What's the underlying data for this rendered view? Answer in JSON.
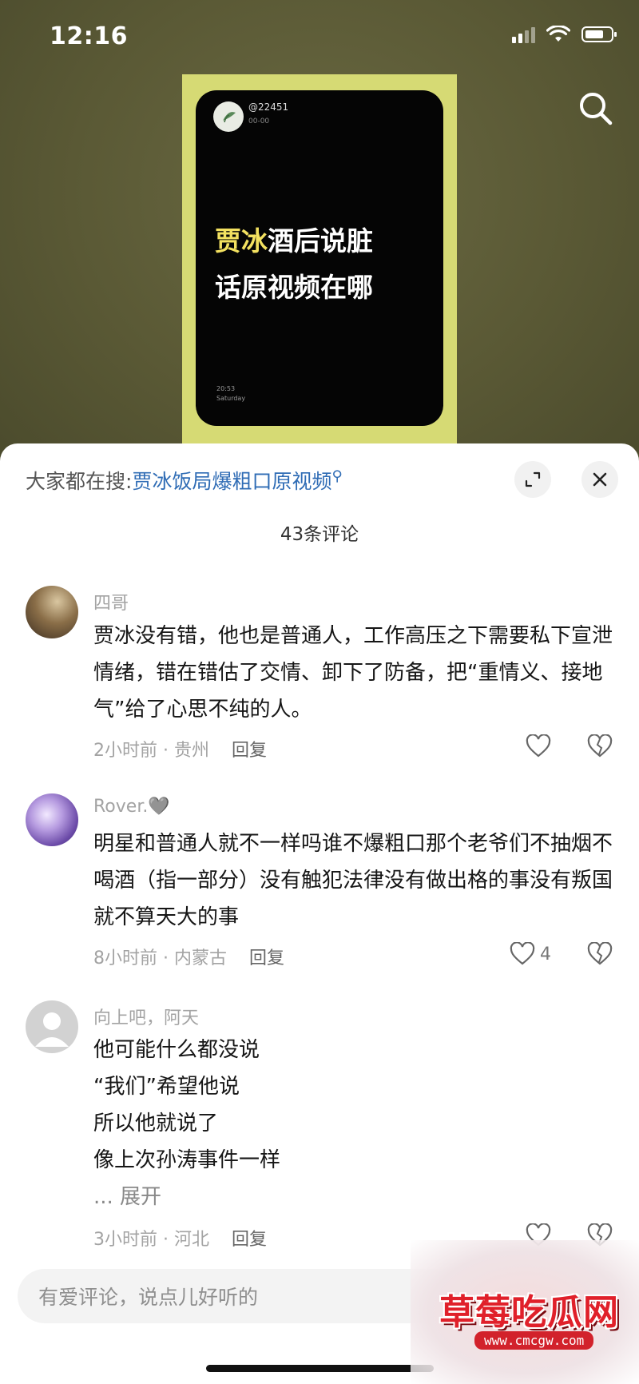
{
  "status_bar": {
    "time": "12:16"
  },
  "poster": {
    "handle": "@22451",
    "date": "00-00",
    "headline_highlight": "贾冰",
    "headline_line1_rest": "酒后说脏",
    "headline_line2": "话原视频在哪",
    "time": "20:53",
    "weekday": "Saturday"
  },
  "sheet": {
    "search_prefix": "大家都在搜:",
    "search_suggestion": "贾冰饭局爆粗口原视频",
    "comment_count": "43条评论"
  },
  "comments": [
    {
      "user": "四哥",
      "text": "贾冰没有错，他也是普通人，工作高压之下需要私下宣泄情绪，错在错估了交情、卸下了防备，把“重情义、接地气”给了心思不纯的人。",
      "time_location": "2小时前 · 贵州",
      "reply": "回复",
      "likes": ""
    },
    {
      "user": "Rover.🩶",
      "text": "明星和普通人就不一样吗谁不爆粗口那个老爷们不抽烟不喝酒（指一部分）没有触犯法律没有做出格的事没有叛国就不算天大的事",
      "time_location": "8小时前 · 内蒙古",
      "reply": "回复",
      "likes": "4"
    },
    {
      "user": "向上吧，阿天",
      "lines": [
        "他可能什么都没说",
        "“我们”希望他说",
        "所以他就说了",
        "像上次孙涛事件一样"
      ],
      "more": "... 展开",
      "time_location": "3小时前 · 河北",
      "reply": "回复",
      "likes": ""
    }
  ],
  "input": {
    "placeholder": "有爱评论，说点儿好听的"
  },
  "watermark": {
    "title": "草莓吃瓜网",
    "url": "www.cmcgw.com"
  },
  "colors": {
    "link": "#2f6cb5",
    "poster_frame": "#d6da74",
    "highlight": "#f3e160",
    "watermark": "#e0202a"
  }
}
